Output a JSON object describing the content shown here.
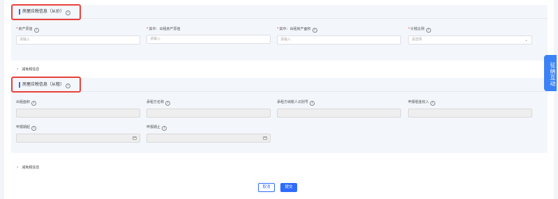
{
  "section1": {
    "title": "房屋应税信息（从价）",
    "fields": [
      {
        "label": "房产原值",
        "required": true,
        "placeholder": "请输入"
      },
      {
        "label": "其中：出租房产原值",
        "required": true,
        "placeholder": "请输入"
      },
      {
        "label": "其中：出租房产面积",
        "required": true,
        "placeholder": "请输入"
      },
      {
        "label": "计税比例",
        "required": true,
        "placeholder": "请选择"
      }
    ],
    "relief": "减免税信息"
  },
  "section2": {
    "title": "房屋应税信息（从租）",
    "fields": [
      {
        "label": "出租面积"
      },
      {
        "label": "承租方名称"
      },
      {
        "label": "承租方纳税人识别号"
      },
      {
        "label": "申报租金收入"
      },
      {
        "label": "申报期起"
      },
      {
        "label": "申报期止"
      }
    ],
    "relief": "减免税信息"
  },
  "actions": {
    "cancel": "取消",
    "submit": "提交"
  },
  "side_tab": {
    "label": "征纳互动"
  },
  "colors": {
    "accent": "#2f6bff",
    "highlight": "#e8413a",
    "side_tab": "#3b82f6"
  }
}
